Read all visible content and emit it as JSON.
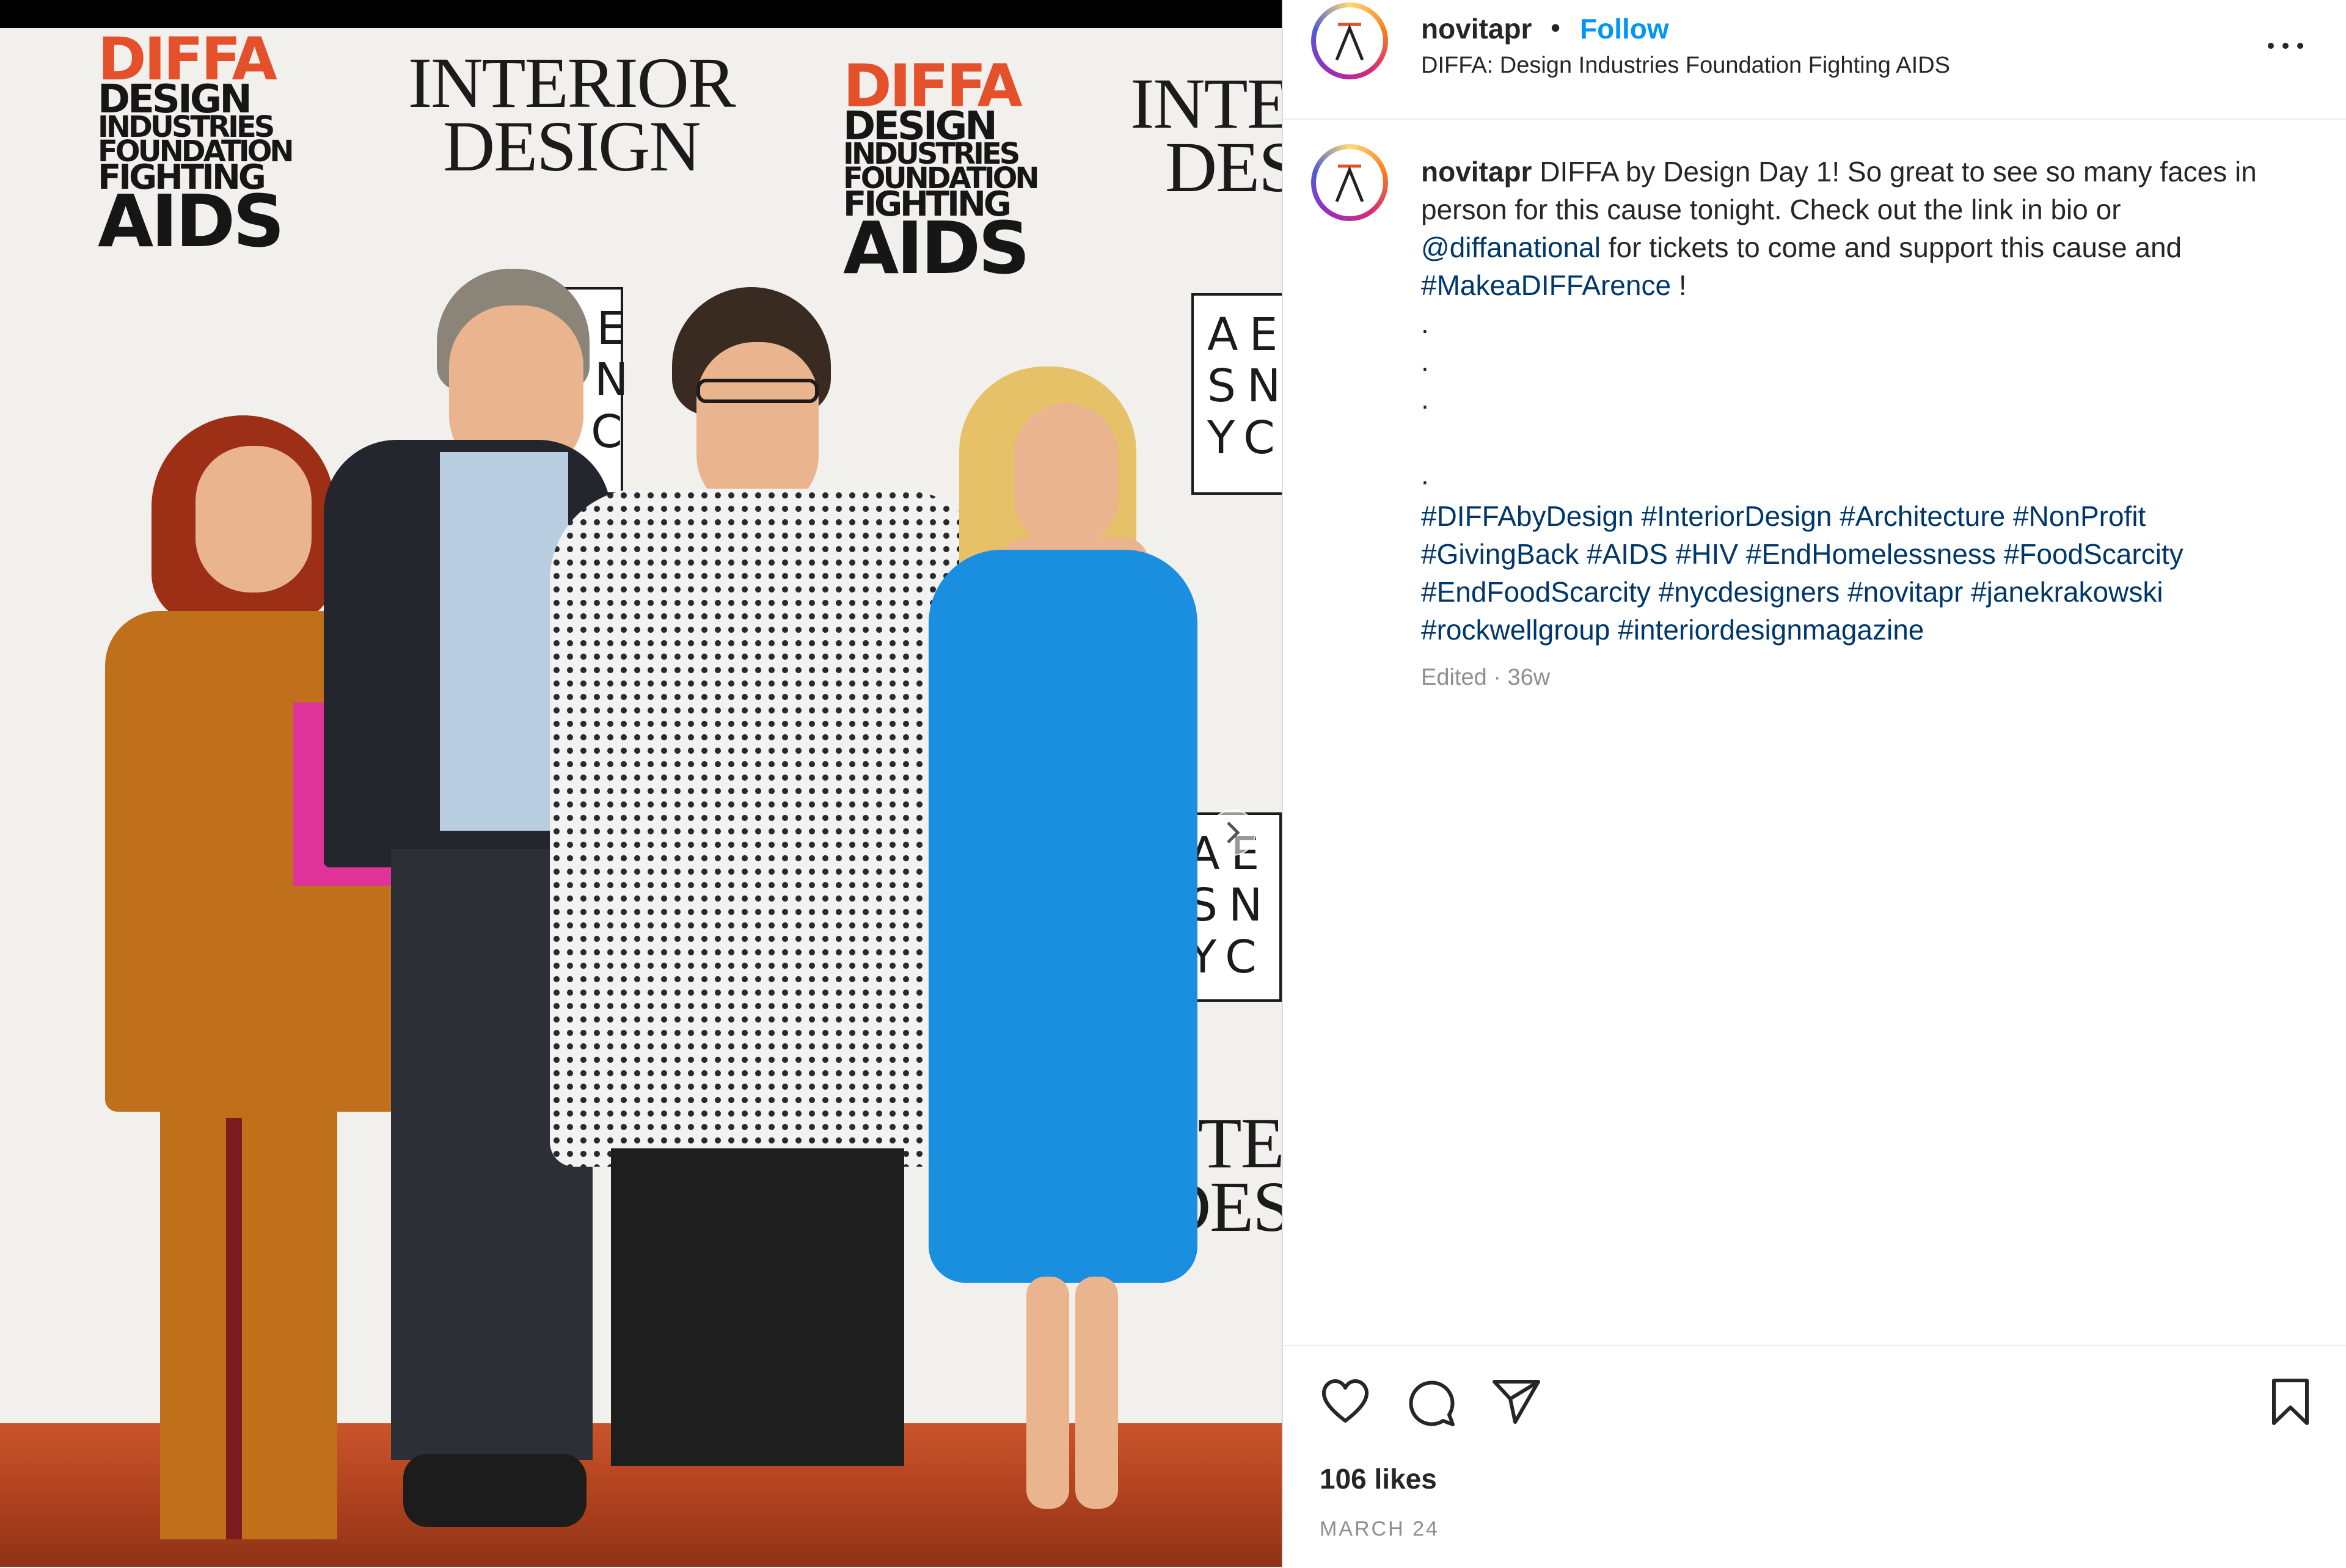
{
  "photo": {
    "alt_logos": {
      "diffa_top": "DIFFA",
      "diffa_lines": [
        "DESIGN",
        "INDUSTRIES",
        "FOUNDATION",
        "FIGHTING"
      ],
      "diffa_bottom": "AIDS",
      "interior_design_lines": [
        "INTERIOR",
        "DESIGN"
      ],
      "aesnyc_lines": [
        "AE",
        "SN",
        "YC"
      ]
    },
    "next_button_icon": "chevron-right-icon"
  },
  "header": {
    "username": "novitapr",
    "separator": "•",
    "follow_label": "Follow",
    "location": "DIFFA: Design Industries Foundation Fighting AIDS",
    "more_icon": "more-horizontal-icon"
  },
  "caption": {
    "username": "novitapr",
    "text_1": "DIFFA by Design Day 1! So great to see so many faces in person for this cause tonight. Check out the link in bio or",
    "mention": "@diffanational",
    "text_2": "for tickets to come and support this cause and",
    "hashtag_inline": "#MakeaDIFFArence",
    "text_3": "!",
    "dots": [
      ".",
      ".",
      ".",
      "",
      "",
      "."
    ],
    "hashtags": [
      "#DIFFAbyDesign",
      "#InteriorDesign",
      "#Architecture",
      "#NonProfit",
      "#GivingBack",
      "#AIDS",
      "#HIV",
      "#EndHomelessness",
      "#FoodScarcity",
      "#EndFoodScarcity",
      "#nycdesigners",
      "#novitapr",
      "#janekrakowski",
      "#rockwellgroup",
      "#interiordesignmagazine"
    ],
    "edited": "Edited · 36w"
  },
  "actions": {
    "like_icon": "heart-icon",
    "comment_icon": "comment-icon",
    "share_icon": "send-icon",
    "save_icon": "bookmark-icon",
    "likes": "106 likes",
    "date": "MARCH 24"
  },
  "colors": {
    "accent": "#0095f6",
    "link": "#00376b",
    "muted": "#8e8e8e",
    "text": "#262626"
  }
}
